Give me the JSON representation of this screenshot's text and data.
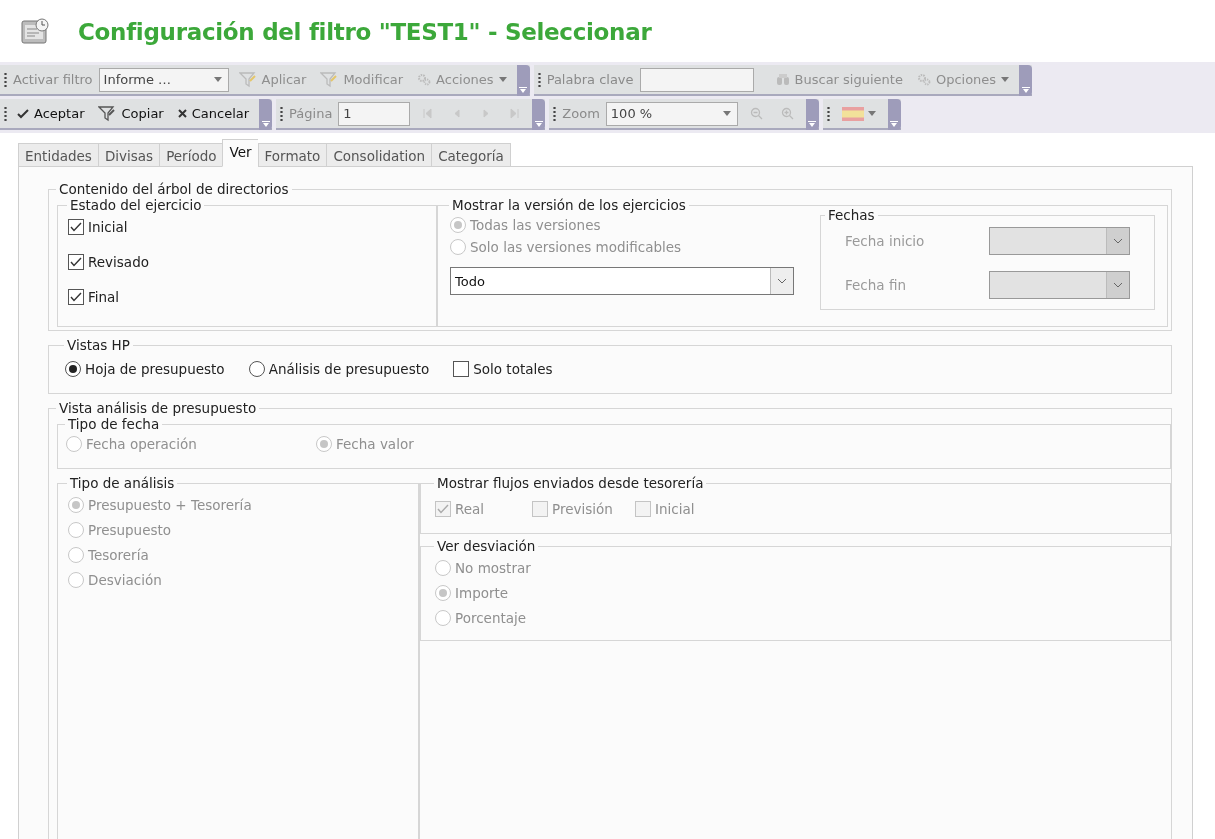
{
  "title": "Configuración del filtro \"TEST1\" - Seleccionar",
  "filter_toolbar": {
    "label": "Activar filtro",
    "combo": "Informe …",
    "buttons": [
      {
        "label": "Aplicar",
        "disabled": true,
        "dropdown": false
      },
      {
        "label": "Modificar",
        "disabled": true,
        "dropdown": false
      },
      {
        "label": "Acciones",
        "disabled": true,
        "dropdown": true
      }
    ]
  },
  "search_toolbar": {
    "label": "Palabra clave",
    "buttons": [
      {
        "label": "Buscar siguiente",
        "disabled": true,
        "dropdown": false
      },
      {
        "label": "Opciones",
        "disabled": true,
        "dropdown": true
      }
    ]
  },
  "action_toolbar": {
    "buttons": [
      {
        "label": "Aceptar",
        "disabled": false
      },
      {
        "label": "Copiar",
        "disabled": false
      },
      {
        "label": "Cancelar",
        "disabled": false
      }
    ]
  },
  "page_toolbar": {
    "label": "Página",
    "value": "1"
  },
  "zoom_toolbar": {
    "label": "Zoom",
    "combo": "100 %"
  },
  "tabs": [
    {
      "label": "Entidades",
      "selected": false
    },
    {
      "label": "Divisas",
      "selected": false
    },
    {
      "label": "Período",
      "selected": false
    },
    {
      "label": "Ver",
      "selected": true
    },
    {
      "label": "Formato",
      "selected": false
    },
    {
      "label": "Consolidation",
      "selected": false
    },
    {
      "label": "Categoría",
      "selected": false
    }
  ],
  "tree_content": {
    "legend": "Contenido del árbol de directorios",
    "status": {
      "legend": "Estado del ejercicio",
      "options": [
        {
          "label": "Inicial",
          "checked": true,
          "disabled": false
        },
        {
          "label": "Revisado",
          "checked": true,
          "disabled": false
        },
        {
          "label": "Final",
          "checked": true,
          "disabled": false
        }
      ]
    },
    "versions": {
      "legend": "Mostrar la versión de los ejercicios",
      "options": [
        {
          "label": "Todas las versiones",
          "selected": true,
          "disabled": true
        },
        {
          "label": "Solo las versiones modificables",
          "selected": false,
          "disabled": true
        }
      ],
      "select": "Todo"
    },
    "dates": {
      "legend": "Fechas",
      "fields": [
        {
          "label": "Fecha inicio",
          "disabled": true
        },
        {
          "label": "Fecha fin",
          "disabled": true
        }
      ]
    }
  },
  "hp_views": {
    "legend": "Vistas HP",
    "options": [
      {
        "kind": "radio",
        "label": "Hoja de presupuesto",
        "selected": true,
        "disabled": false
      },
      {
        "kind": "radio",
        "label": "Análisis de presupuesto",
        "selected": false,
        "disabled": false
      },
      {
        "kind": "checkbox",
        "label": "Solo totales",
        "checked": false,
        "disabled": false
      }
    ]
  },
  "budget_analysis": {
    "legend": "Vista análisis de presupuesto",
    "date_type": {
      "legend": "Tipo de fecha",
      "options": [
        {
          "label": "Fecha operación",
          "selected": false,
          "disabled": true
        },
        {
          "label": "Fecha valor",
          "selected": true,
          "disabled": true
        }
      ]
    },
    "analysis_type": {
      "legend": "Tipo de análisis",
      "options": [
        {
          "label": "Presupuesto + Tesorería",
          "selected": true,
          "disabled": true
        },
        {
          "label": "Presupuesto",
          "selected": false,
          "disabled": true
        },
        {
          "label": "Tesorería",
          "selected": false,
          "disabled": true
        },
        {
          "label": "Desviación",
          "selected": false,
          "disabled": true
        }
      ]
    },
    "flows": {
      "legend": "Mostrar flujos enviados desde tesorería",
      "options": [
        {
          "label": "Real",
          "checked": true,
          "disabled": true
        },
        {
          "label": "Previsión",
          "checked": false,
          "disabled": true
        },
        {
          "label": "Inicial",
          "checked": false,
          "disabled": true
        }
      ]
    },
    "deviation": {
      "legend": "Ver desviación",
      "options": [
        {
          "label": "No mostrar",
          "selected": false,
          "disabled": true
        },
        {
          "label": "Importe",
          "selected": true,
          "disabled": true
        },
        {
          "label": "Porcentaje",
          "selected": false,
          "disabled": true
        }
      ]
    }
  }
}
